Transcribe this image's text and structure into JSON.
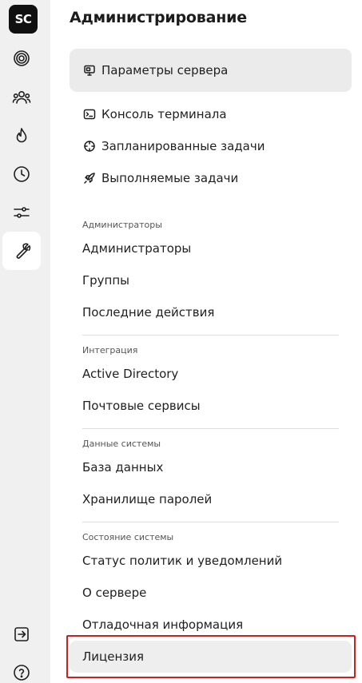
{
  "app": {
    "logo_text": "SC"
  },
  "rail": {
    "items": [
      {
        "name": "target-icon",
        "active": false
      },
      {
        "name": "users-icon",
        "active": false
      },
      {
        "name": "flame-icon",
        "active": false
      },
      {
        "name": "clock-icon",
        "active": false
      },
      {
        "name": "sliders-icon",
        "active": false
      },
      {
        "name": "wrench-icon",
        "active": true
      }
    ],
    "bottom": [
      {
        "name": "logout-icon"
      },
      {
        "name": "help-icon"
      }
    ]
  },
  "page": {
    "title": "Администрирование"
  },
  "menu": {
    "server_params": "Параметры сервера",
    "terminal": "Консоль терминала",
    "scheduled": "Запланированные задачи",
    "running": "Выполняемые задачи"
  },
  "sections": {
    "admins": {
      "label": "Администраторы",
      "items": [
        "Администраторы",
        "Группы",
        "Последние действия"
      ]
    },
    "integration": {
      "label": "Интеграция",
      "items": [
        "Active Directory",
        "Почтовые сервисы"
      ]
    },
    "system_data": {
      "label": "Данные системы",
      "items": [
        "База данных",
        "Хранилище паролей"
      ]
    },
    "system_state": {
      "label": "Состояние системы",
      "items": [
        "Статус политик и уведомлений",
        "О сервере",
        "Отладочная информация",
        "Лицензия"
      ]
    }
  },
  "colors": {
    "highlight": "#cc1f1f",
    "rail_bg": "#f0f0f0",
    "selected_bg": "#ebebeb"
  }
}
